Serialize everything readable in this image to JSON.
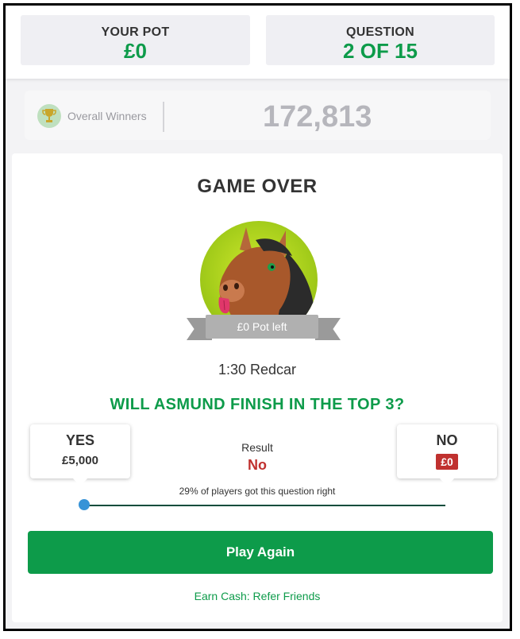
{
  "header": {
    "pot_label": "YOUR POT",
    "pot_value": "£0",
    "question_label": "QUESTION",
    "question_value": "2 OF 15"
  },
  "winners": {
    "label": "Overall Winners",
    "count": "172,813",
    "icon": "trophy-icon"
  },
  "game": {
    "title": "GAME OVER",
    "pot_left": "£0 Pot left",
    "race": "1:30 Redcar",
    "question": "WILL ASMUND FINISH IN THE TOP 3?",
    "yes_label": "YES",
    "yes_value": "£5,000",
    "result_label": "Result",
    "result_value": "No",
    "no_label": "NO",
    "no_value": "£0",
    "percent_text": "29% of players got this question right",
    "percent_right": 29,
    "play_again": "Play Again",
    "refer": "Earn Cash: Refer Friends"
  },
  "colors": {
    "green": "#0d9b4a",
    "red": "#c0312f",
    "blue": "#3793d7",
    "avatar_bg": "#a3cc1a"
  }
}
